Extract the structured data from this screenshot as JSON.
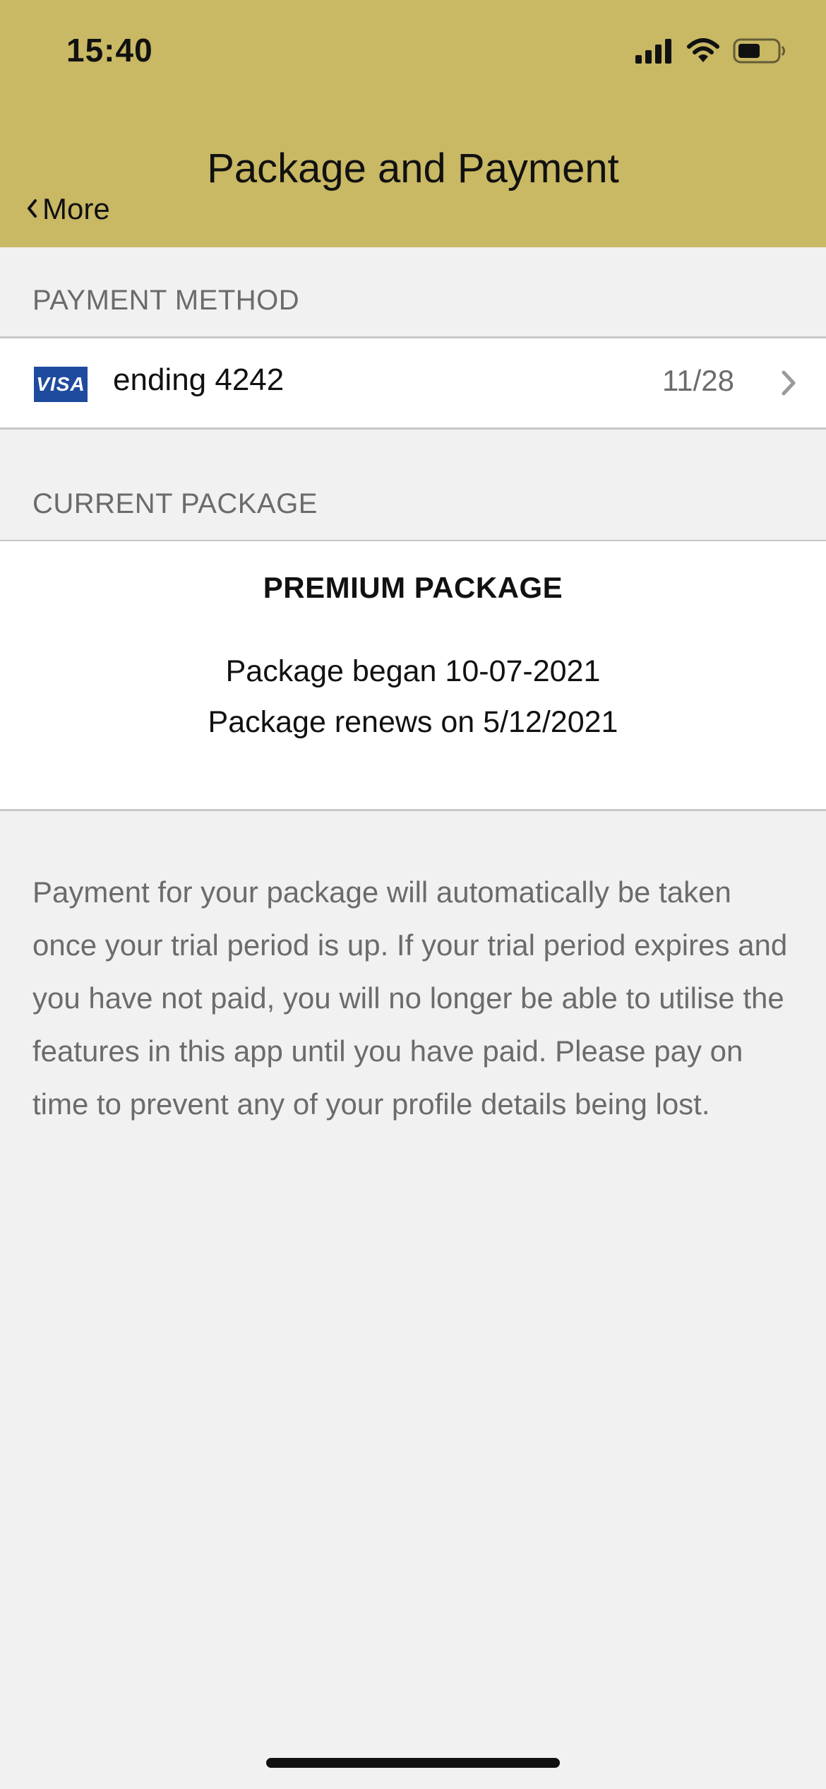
{
  "status_bar": {
    "time": "15:40"
  },
  "header": {
    "title": "Package and Payment",
    "back_label": "More",
    "background_color": "#c9b864"
  },
  "payment_method": {
    "section_label": "PAYMENT METHOD",
    "card_brand": "VISA",
    "card_text": "ending 4242",
    "expiry": "11/28"
  },
  "current_package": {
    "section_label": "CURRENT PACKAGE",
    "package_name": "PREMIUM PACKAGE",
    "began": "Package began 10-07-2021",
    "renews": "Package renews on 5/12/2021"
  },
  "note": "Payment for your package will automatically be taken once your trial period is up. If your trial period expires and you have not paid, you will no longer be able to utilise the features in this app until you have paid. Please pay on time to prevent any of your profile details being lost.",
  "icons": {
    "signal": "cellular-signal-icon",
    "wifi": "wifi-icon",
    "battery": "battery-icon",
    "back": "chevron-left-icon",
    "row_disclosure": "chevron-right-icon"
  }
}
